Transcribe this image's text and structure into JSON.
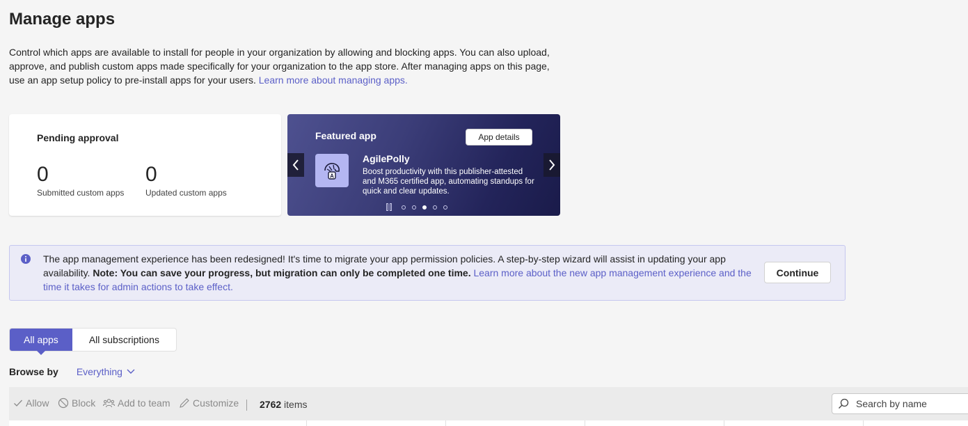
{
  "page": {
    "title": "Manage apps",
    "intro": "Control which apps are available to install for people in your organization by allowing and blocking apps. You can also upload, approve, and publish custom apps made specifically for your organization to the app store. After managing apps on this page, use an app setup policy to pre-install apps for your users.",
    "intro_link": "Learn more about managing apps."
  },
  "pending": {
    "title": "Pending approval",
    "submitted_count": "0",
    "submitted_label": "Submitted custom apps",
    "updated_count": "0",
    "updated_label": "Updated custom apps"
  },
  "featured": {
    "label": "Featured app",
    "details_button": "App details",
    "app_name": "AgilePolly",
    "app_desc": "Boost productivity with this publisher-attested and M365 certified app, automating standups for quick and clear updates.",
    "slide_count": 5,
    "active_slide": 3,
    "background_colors": [
      "#4e5190",
      "#1a1b4a"
    ]
  },
  "banner": {
    "text_pre": "The app management experience has been redesigned! It's time to migrate your app permission policies. A step-by-step wizard will assist in updating your app availability.",
    "note": "Note: You can save your progress, but migration can only be completed one time.",
    "link": "Learn more about the new app management experience and the time it takes for admin actions to take effect.",
    "continue_button": "Continue"
  },
  "tabs": [
    {
      "label": "All apps",
      "active": true
    },
    {
      "label": "All subscriptions",
      "active": false
    }
  ],
  "browse": {
    "label": "Browse by",
    "value": "Everything"
  },
  "toolbar": {
    "allow": "Allow",
    "block": "Block",
    "add_to_team": "Add to team",
    "customize": "Customize",
    "items_count": "2762",
    "items_label": "items",
    "search_placeholder": "Search by name"
  },
  "colors": {
    "accent": "#5b5fc7",
    "banner_bg": "#ebebf7",
    "page_bg": "#f5f5f5"
  }
}
